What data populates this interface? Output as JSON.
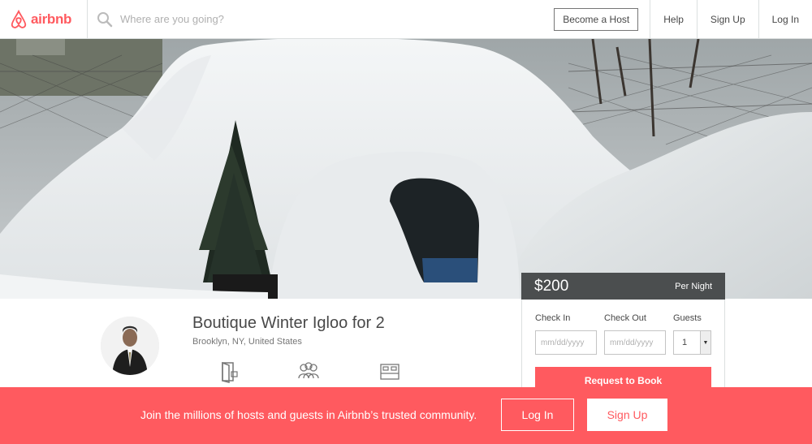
{
  "header": {
    "logo_text": "airbnb",
    "search_placeholder": "Where are you going?",
    "become_host": "Become a Host",
    "help": "Help",
    "sign_up": "Sign Up",
    "log_in": "Log In"
  },
  "hero": {
    "icon": "snow-igloo-photo"
  },
  "listing": {
    "title": "Boutique Winter Igloo for 2",
    "location": "Brooklyn, NY, United States",
    "amenities": [
      {
        "icon": "door-icon"
      },
      {
        "icon": "guests-icon"
      },
      {
        "icon": "bed-icon"
      }
    ]
  },
  "booking": {
    "price": "$200",
    "per_night": "Per Night",
    "check_in_label": "Check In",
    "check_out_label": "Check Out",
    "guests_label": "Guests",
    "check_in_placeholder": "mm/dd/yyyy",
    "check_out_placeholder": "mm/dd/yyyy",
    "guests_value": "1",
    "request_button": "Request to Book"
  },
  "banner": {
    "text": "Join the millions of hosts and guests in Airbnb’s trusted community.",
    "log_in": "Log In",
    "sign_up": "Sign Up"
  },
  "colors": {
    "brand": "#ff5a5f",
    "price_bar": "#3c3f40"
  }
}
